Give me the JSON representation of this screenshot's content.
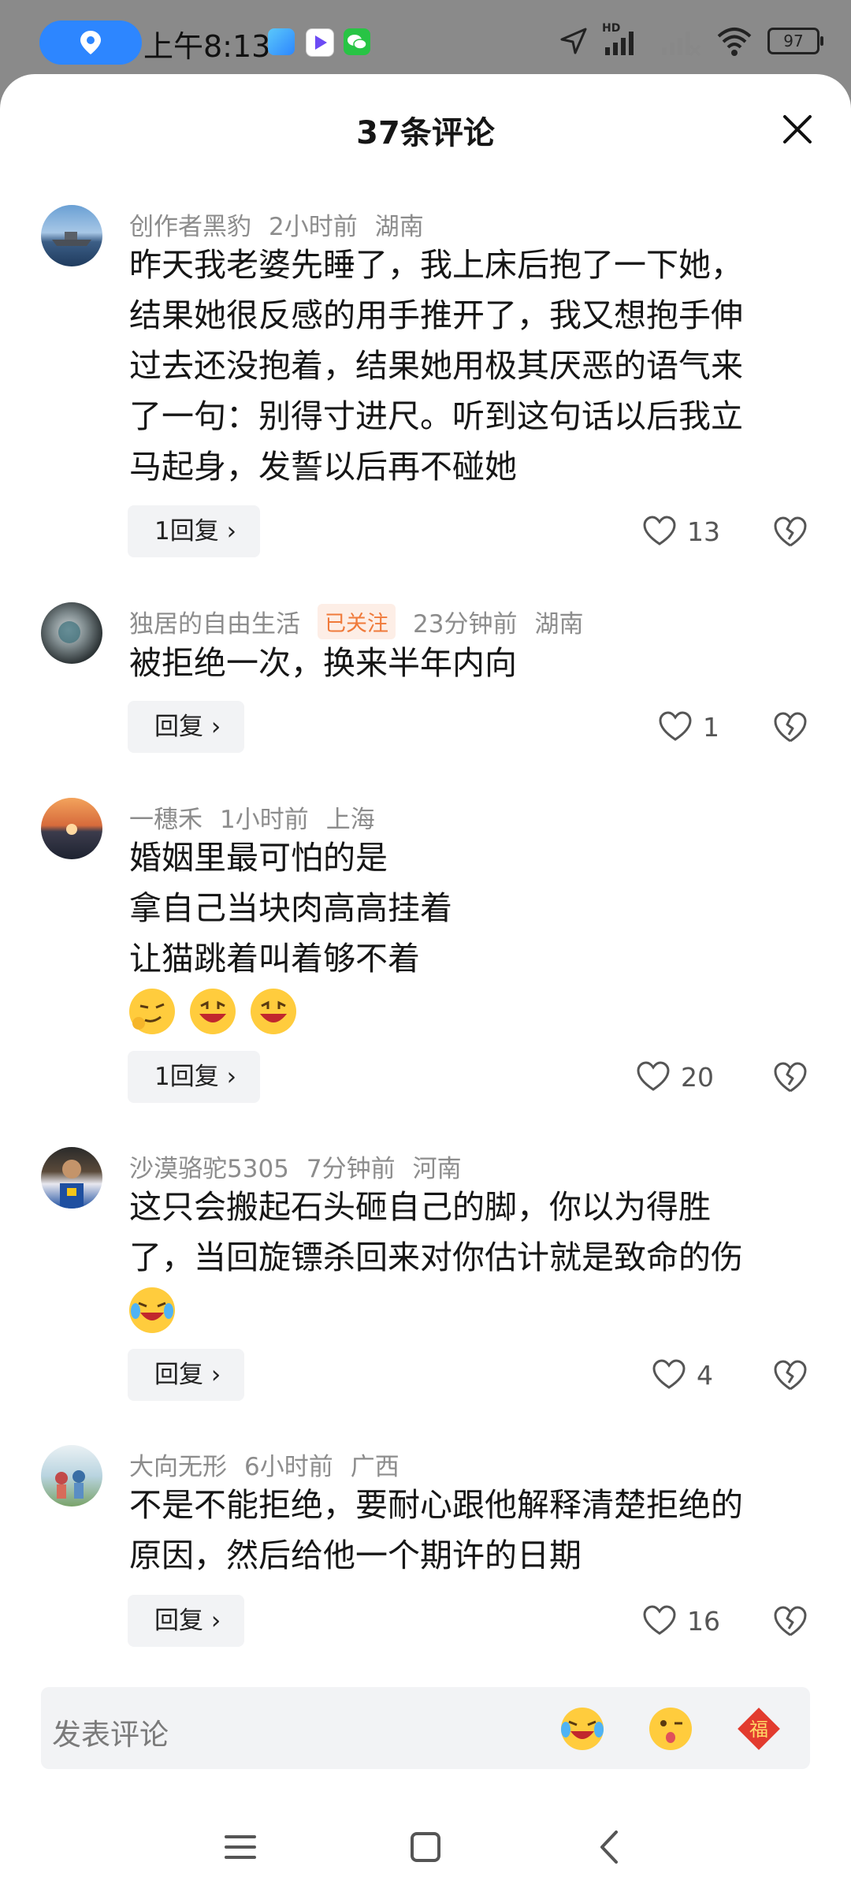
{
  "status_bar": {
    "time": "上午8:13",
    "battery": "97",
    "network_label": "HD"
  },
  "sheet": {
    "title": "37条评论"
  },
  "comments": [
    {
      "author": "创作者黑豹",
      "time": "2小时前",
      "location": "湖南",
      "lines": [
        "昨天我老婆先睡了，我上床后抱了一下她，",
        "结果她很反感的用手推开了，我又想抱手伸",
        "过去还没抱着，结果她用极其厌恶的语气来",
        "了一句：别得寸进尺。听到这句话以后我立",
        "马起身，发誓以后再不碰她"
      ],
      "reply_label": "1回复",
      "likes": "13"
    },
    {
      "author": "独居的自由生活",
      "badge": "已关注",
      "time": "23分钟前",
      "location": "湖南",
      "lines": [
        "被拒绝一次，换来半年内向"
      ],
      "reply_label": "回复",
      "likes": "1"
    },
    {
      "author": "一穗禾",
      "time": "1小时前",
      "location": "上海",
      "lines": [
        "婚姻里最可怕的是",
        "拿自己当块肉高高挂着",
        "让猫跳着叫着够不着"
      ],
      "emojis": [
        "smirk-emoji",
        "laugh-emoji",
        "laugh-emoji"
      ],
      "reply_label": "1回复",
      "likes": "20"
    },
    {
      "author": "沙漠骆驼5305",
      "time": "7分钟前",
      "location": "河南",
      "lines": [
        "这只会搬起石头砸自己的脚，你以为得胜",
        "了，当回旋镖杀回来对你估计就是致命的伤"
      ],
      "emojis": [
        "cry-laugh-emoji"
      ],
      "reply_label": "回复",
      "likes": "4"
    },
    {
      "author": "大向无形",
      "time": "6小时前",
      "location": "广西",
      "lines": [
        "不是不能拒绝，要耐心跟他解释清楚拒绝的",
        "原因，然后给他一个期许的日期"
      ],
      "reply_label": "回复",
      "likes": "16"
    }
  ],
  "input_bar": {
    "placeholder": "发表评论",
    "quick_emojis": [
      "cry-laugh-emoji",
      "wink-tongue-emoji",
      "fu-emoji"
    ],
    "fu_char": "福"
  },
  "colors": {
    "accent_blue": "#2d86ff",
    "followed_text": "#f07a3a",
    "followed_bg": "#fdeee6",
    "meta_gray": "#8c8c8c"
  }
}
